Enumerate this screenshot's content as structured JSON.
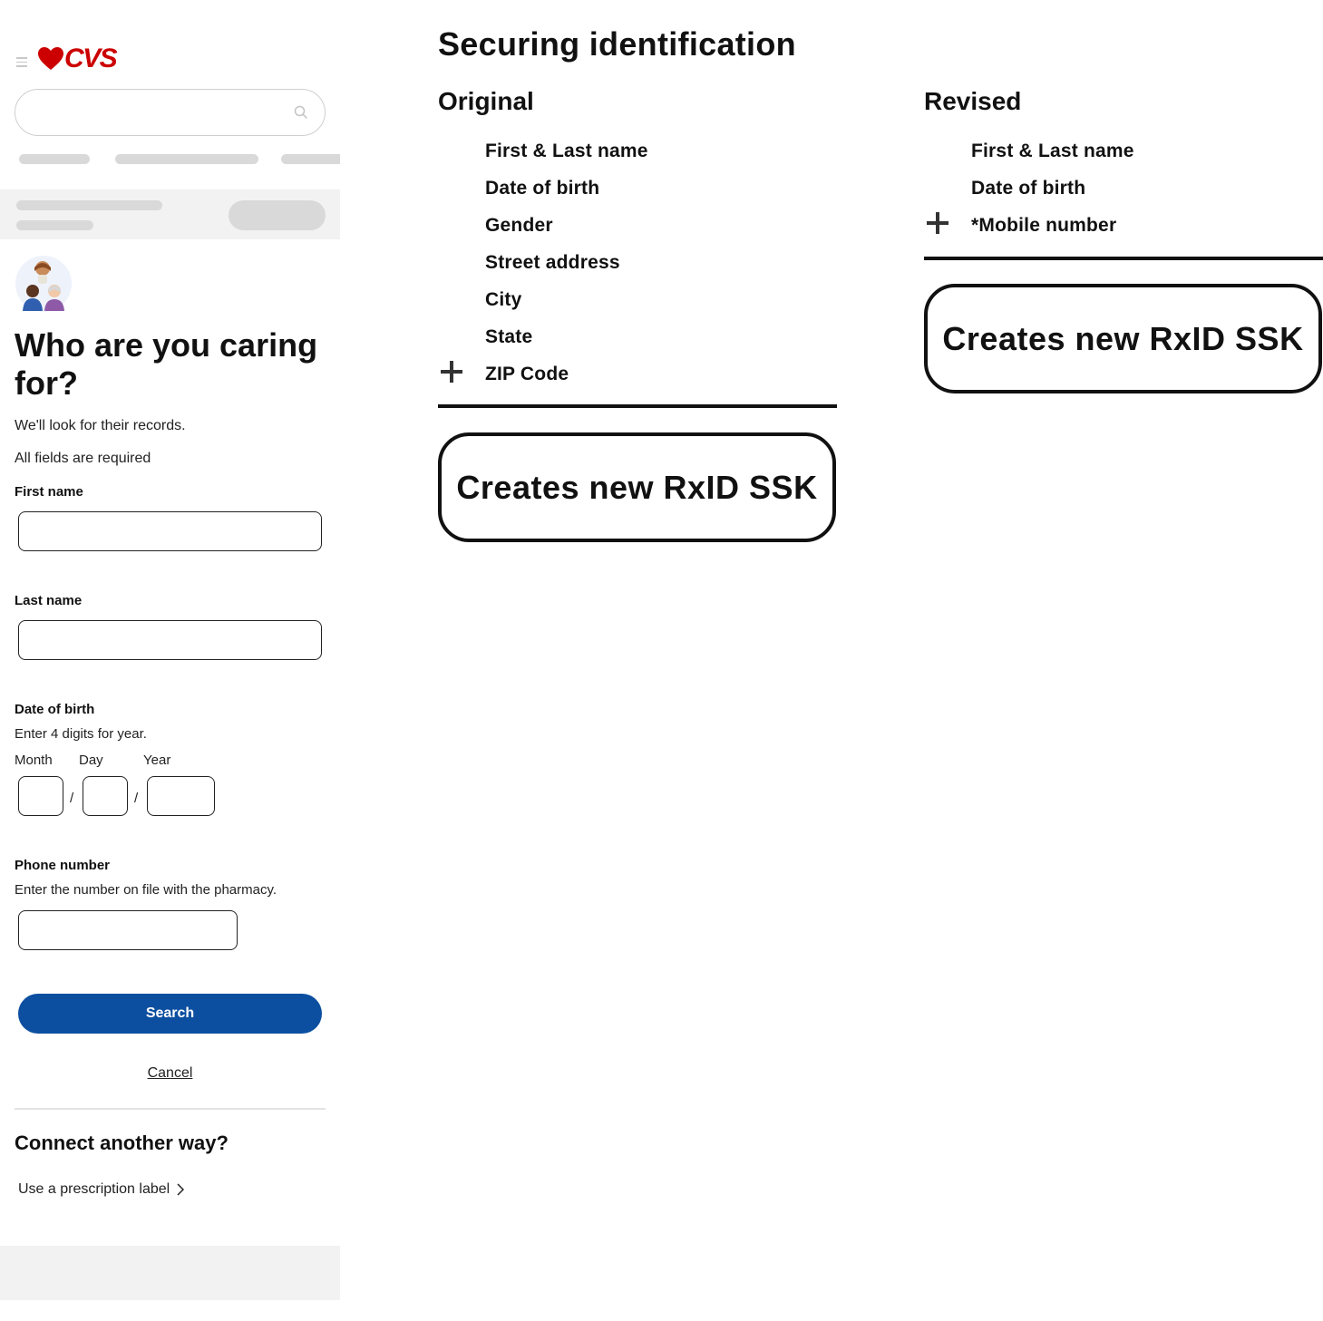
{
  "app": {
    "brand": "CVS",
    "brand_color": "#cc0000",
    "accent_color": "#0c4fa0"
  },
  "icons": [
    "menu-icon",
    "heart-logo-icon",
    "search-icon",
    "family-avatar-icon",
    "chevron-right-icon",
    "plus-icon"
  ],
  "form": {
    "title": "Who are you caring for?",
    "intro": "We'll look for their records.",
    "required_note": "All fields are required",
    "first_name_label": "First name",
    "first_name_value": "",
    "last_name_label": "Last name",
    "last_name_value": "",
    "dob_label": "Date of birth",
    "dob_hint": "Enter 4 digits for year.",
    "month_label": "Month",
    "day_label": "Day",
    "year_label": "Year",
    "dob_separator": "/",
    "phone_label": "Phone number",
    "phone_hint": "Enter the number on file with the pharmacy.",
    "phone_value": "",
    "search_button": "Search",
    "cancel_link": "Cancel",
    "alt_heading": "Connect another way?",
    "alt_link": "Use a prescription label"
  },
  "comparison": {
    "title": "Securing identification",
    "original": {
      "heading": "Original",
      "items": [
        "First & Last name",
        "Date of birth",
        "Gender",
        "Street address",
        "City",
        "State",
        "ZIP Code"
      ],
      "added_item": "ZIP Code",
      "result": "Creates new RxID SSK"
    },
    "revised": {
      "heading": "Revised",
      "items": [
        "First & Last name",
        "Date of birth",
        "*Mobile number"
      ],
      "added_item": "*Mobile number",
      "result": "Creates new RxID SSK"
    }
  }
}
